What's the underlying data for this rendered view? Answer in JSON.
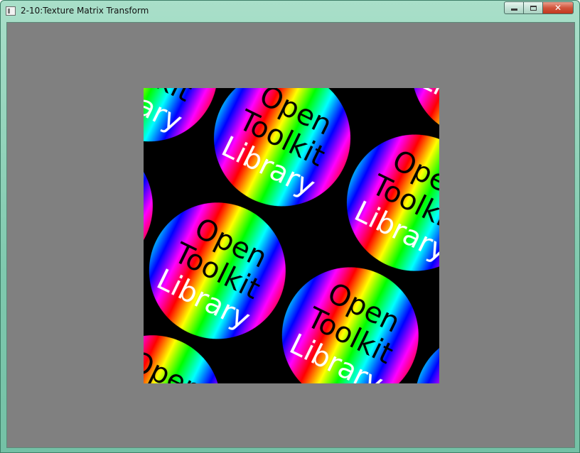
{
  "window": {
    "title": "2-10:Texture Matrix Transform",
    "icon": "app-window-icon",
    "caption_buttons": [
      "minimize",
      "maximize",
      "close"
    ],
    "close_glyph": "✕"
  },
  "scene": {
    "background_color": "#808080",
    "texture_lines": [
      "Open",
      "Toolkit",
      "Library"
    ],
    "text_colors": {
      "Open": "#000000",
      "Toolkit": "#000000",
      "Library": "#ffffff"
    }
  }
}
